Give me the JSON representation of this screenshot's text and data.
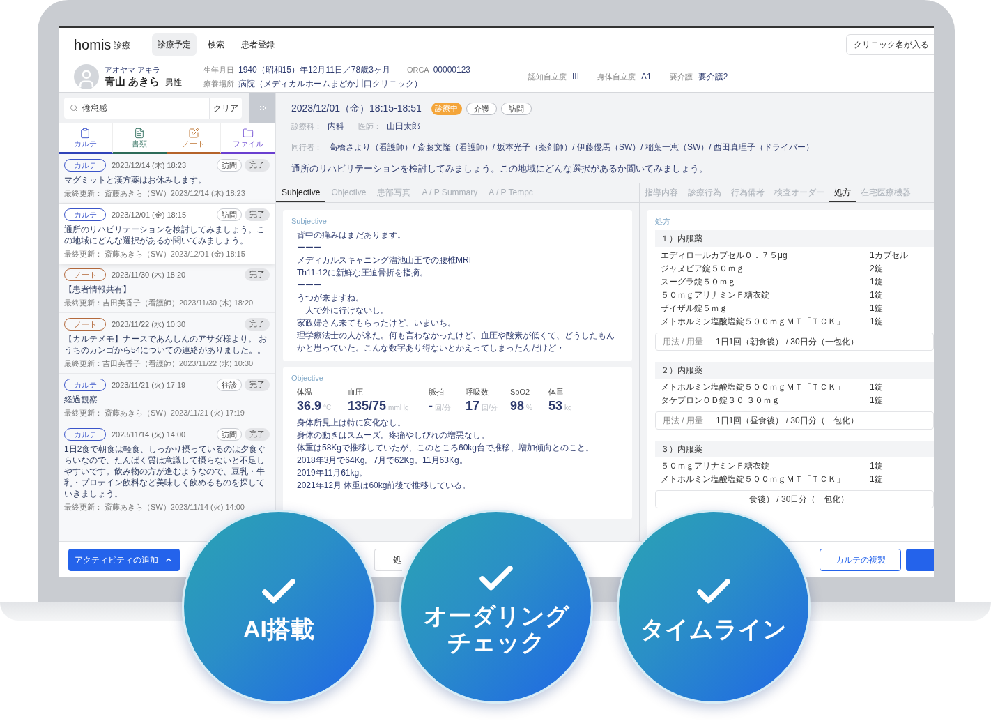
{
  "header": {
    "logo": "homis",
    "logo_sub": "診療",
    "nav": [
      {
        "label": "診療予定",
        "selected": true
      },
      {
        "label": "検索",
        "selected": false
      },
      {
        "label": "患者登録",
        "selected": false
      }
    ],
    "clinic": "クリニック名が入る"
  },
  "patient": {
    "kana": "アオヤマ アキラ",
    "name": "青山 あきら",
    "sex": "男性",
    "info_rows": [
      [
        {
          "label": "生年月日",
          "value": "1940（昭和15）年12月11日／78歳3ヶ月"
        },
        {
          "label": "ORCA",
          "value": "00000123"
        }
      ],
      [
        {
          "label": "療養場所",
          "value": "病院（メディカルホームまどか川口クリニック）"
        }
      ]
    ],
    "care": [
      {
        "label": "認知自立度",
        "value": "III"
      },
      {
        "label": "身体自立度",
        "value": "A1"
      },
      {
        "label": "要介護",
        "value": "要介護2"
      }
    ]
  },
  "sidebar": {
    "search": {
      "value": "倦怠感"
    },
    "clear": "クリア",
    "tabs": [
      {
        "label": "カルテ",
        "kind": "karte"
      },
      {
        "label": "書類",
        "kind": "doc"
      },
      {
        "label": "ノート",
        "kind": "note"
      },
      {
        "label": "ファイル",
        "kind": "file"
      }
    ],
    "records": [
      {
        "kind": "karte",
        "tag": "カルテ",
        "date": "2023/12/14 (木) 18:23",
        "badges": [
          {
            "kind": "visit",
            "label": "訪問"
          },
          {
            "kind": "status",
            "label": "完了"
          }
        ],
        "text": "マグミットと漢方薬はお休みします。",
        "updated": "最終更新： 斎藤あきら（SW）2023/12/14 (木) 18:23",
        "selected": false
      },
      {
        "kind": "karte",
        "tag": "カルテ",
        "date": "2023/12/01 (金) 18:15",
        "badges": [
          {
            "kind": "visit",
            "label": "訪問"
          },
          {
            "kind": "status",
            "label": "完了"
          }
        ],
        "text": "通所のリハビリテーションを検討してみましょう。この地域にどんな選択があるか聞いてみましょう。",
        "updated": "最終更新： 斎藤あきら（SW）2023/12/01 (金) 18:15",
        "selected": true
      },
      {
        "kind": "note",
        "tag": "ノート",
        "date": "2023/11/30 (木) 18:20",
        "badges": [
          {
            "kind": "status",
            "label": "完了"
          }
        ],
        "text": "【患者情報共有】",
        "updated": "最終更新：吉田美香子（看護師）2023/11/30 (木) 18:20",
        "selected": false
      },
      {
        "kind": "note",
        "tag": "ノート",
        "date": "2023/11/22 (水) 10:30",
        "badges": [
          {
            "kind": "status",
            "label": "完了"
          }
        ],
        "text": "【カルテメモ】ナースであんしんのアサダ様より。 おうちのカンゴから54についての連絡がありました。。",
        "updated": "最終更新：吉田美香子（看護師）2023/11/22 (水) 10:30",
        "selected": false
      },
      {
        "kind": "karte",
        "tag": "カルテ",
        "date": "2023/11/21 (火) 17:19",
        "badges": [
          {
            "kind": "visit",
            "label": "往診"
          },
          {
            "kind": "status",
            "label": "完了"
          }
        ],
        "text": "経過観察",
        "updated": "最終更新： 斎藤あきら（SW）2023/11/21 (火) 17:19",
        "selected": false
      },
      {
        "kind": "karte",
        "tag": "カルテ",
        "date": "2023/11/14 (火) 14:00",
        "badges": [
          {
            "kind": "visit",
            "label": "訪問"
          },
          {
            "kind": "status",
            "label": "完了"
          }
        ],
        "text": "1日2食で朝食は軽食、しっかり摂っているのは夕食ぐらいなので、たんぱく質は意識して摂らないと不足しやすいです。飲み物の方が進むようなので、豆乳・牛乳・プロテイン飲料など美味しく飲めるものを探していきましょう。",
        "updated": "最終更新： 斎藤あきら（SW）2023/11/14 (火) 14:00",
        "selected": false
      }
    ],
    "add_button": "アクティビティの追加"
  },
  "visit": {
    "datetime": "2023/12/01（金）18:15-18:51",
    "badges": [
      {
        "kind": "active",
        "label": "診療中"
      },
      {
        "kind": "outline",
        "label": "介護"
      },
      {
        "kind": "outline",
        "label": "訪問"
      }
    ],
    "meta": [
      {
        "label": "診療科：",
        "value": "内科"
      },
      {
        "label": "医師：",
        "value": "山田太郎"
      }
    ],
    "companions": {
      "label": "同行者：",
      "value": "高橋さより（看護師）/ 斎藤文隆（看護師）/  坂本光子（薬剤師）/ 伊藤優馬（SW）/ 稲葉一恵（SW）/  西田真理子（ドライバー）"
    },
    "summary": "通所のリハビリテーションを検討してみましょう。この地域にどんな選択があるか聞いてみましょう。"
  },
  "soap_tabs": [
    {
      "label": "Subjective",
      "selected": true
    },
    {
      "label": "Objective",
      "selected": false
    },
    {
      "label": "患部写真",
      "selected": false
    },
    {
      "label": "A / P Summary",
      "selected": false
    },
    {
      "label": "A / P Tempc",
      "selected": false
    }
  ],
  "subjective": {
    "title": "Subjective",
    "lines": [
      "背中の痛みはまだあります。",
      "ーーー",
      "メディカルスキャニング溜池山王での腰椎MRI",
      "Th11-12に新鮮な圧迫骨折を指摘。",
      "ーーー",
      "うつが来ますね。",
      "一人で外に行けないし。",
      "家政婦さん来てもらったけど、いまいち。",
      "理学療法士の人が来た。何も言わなかったけど、血圧や酸素が低くて、どうしたもんかと思っていた。こんな数字あり得ないとかえってしまったんだけど・"
    ]
  },
  "objective": {
    "title": "Objective",
    "vitals": [
      {
        "label": "体温",
        "value": "36.9",
        "unit": "°C"
      },
      {
        "label": "血圧",
        "value": "135/75",
        "unit": "mmHg"
      },
      {
        "label": "脈拍",
        "value": "-",
        "unit": "回/分"
      },
      {
        "label": "呼吸数",
        "value": "17",
        "unit": "回/分"
      },
      {
        "label": "SpO2",
        "value": "98",
        "unit": "%"
      },
      {
        "label": "体重",
        "value": "53",
        "unit": "kg"
      }
    ],
    "lines": [
      "身体所見上は特に変化なし。",
      "身体の動きはスムーズ。疼痛やしびれの増悪なし。",
      "体重は58Kgで推移していたが、このところ60kg台で推移、増加傾向とのこと。",
      "2018年3月で64Kg。7月で62Kg。11月63Kg。",
      "2019年11月61kg。",
      "2021年12月 体重は60kg前後で推移している。"
    ]
  },
  "order_tabs": [
    {
      "label": "指導内容",
      "selected": false
    },
    {
      "label": "診療行為",
      "selected": false
    },
    {
      "label": "行為備考",
      "selected": false
    },
    {
      "label": "検査オーダー",
      "selected": false
    },
    {
      "label": "処方",
      "selected": true
    },
    {
      "label": "在宅医療機器",
      "selected": false
    }
  ],
  "prescription": {
    "title": "処方",
    "groups": [
      {
        "title": "１）内服薬",
        "items": [
          {
            "name": "エディロールカプセル０．７５μg",
            "qty": "1カプセル"
          },
          {
            "name": "ジャヌビア錠５０ｍｇ",
            "qty": "2錠"
          },
          {
            "name": "スーグラ錠５０ｍｇ",
            "qty": "1錠"
          },
          {
            "name": "５０ｍｇアリナミンＦ糖衣錠",
            "qty": "1錠"
          },
          {
            "name": "ザイザル錠５ｍｇ",
            "qty": "1錠"
          },
          {
            "name": "メトホルミン塩酸塩錠５００ｍｇＭＴ「ＴＣＫ」",
            "qty": "1錠"
          }
        ],
        "dosage": {
          "label": "用法 / 用量",
          "value": "1日1回（朝食後） / 30日分（一包化）"
        }
      },
      {
        "title": "２）内服薬",
        "items": [
          {
            "name": "メトホルミン塩酸塩錠５００ｍｇＭＴ「ＴＣＫ」",
            "qty": "1錠"
          },
          {
            "name": "タケプロンＯＤ錠３０ ３０ｍｇ",
            "qty": "1錠"
          }
        ],
        "dosage": {
          "label": "用法 / 用量",
          "value": "1日1回（昼食後） / 30日分（一包化）"
        }
      },
      {
        "title": "３）内服薬",
        "items": [
          {
            "name": "５０ｍｇアリナミンＦ糖衣錠",
            "qty": "1錠"
          },
          {
            "name": "メトホルミン塩酸塩錠５００ｍｇＭＴ「ＴＣＫ」",
            "qty": "1錠"
          }
        ],
        "dosage": {
          "value": "食後） / 30日分（一包化）"
        }
      }
    ]
  },
  "footer": {
    "middle_button": "処",
    "copy_button": "カルテの複製"
  },
  "features": [
    {
      "lines": [
        "AI搭載"
      ]
    },
    {
      "lines": [
        "オーダリング",
        "チェック"
      ]
    },
    {
      "lines": [
        "タイムライン"
      ]
    }
  ]
}
